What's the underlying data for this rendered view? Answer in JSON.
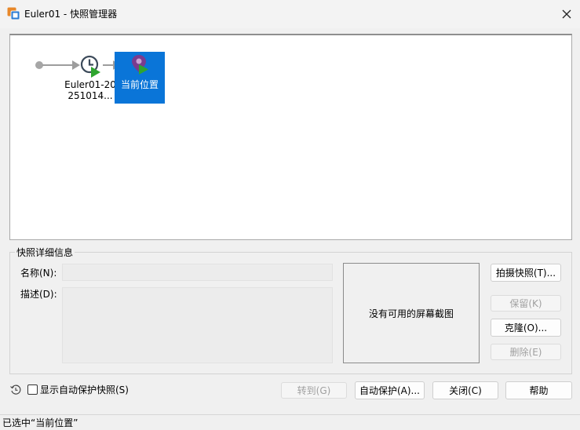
{
  "window": {
    "title": "Euler01 - 快照管理器"
  },
  "tree": {
    "snapshot_label": "Euler01-20\n251014...",
    "current_label": "当前位置"
  },
  "details": {
    "group_title": "快照详细信息",
    "name_label": "名称(N):",
    "name_value": "",
    "desc_label": "描述(D):",
    "desc_value": "",
    "no_screenshot": "没有可用的屏幕截图"
  },
  "buttons": {
    "take_snapshot": "拍摄快照(T)...",
    "keep": "保留(K)",
    "clone": "克隆(O)...",
    "delete": "删除(E)",
    "goto": "转到(G)",
    "autoprotect": "自动保护(A)...",
    "close": "关闭(C)",
    "help": "帮助"
  },
  "options": {
    "show_autoprotect_label": "显示自动保护快照(S)",
    "show_autoprotect_checked": false
  },
  "status": {
    "text": "已选中“当前位置”"
  },
  "colors": {
    "selection": "#0a75d8",
    "play_green": "#2fa52f",
    "pin_purple": "#7a3b8f"
  },
  "icons": [
    "vmware-app-icon",
    "close-icon",
    "snapshot-clock-icon",
    "current-location-pin-icon",
    "autoprotect-clock-icon"
  ]
}
